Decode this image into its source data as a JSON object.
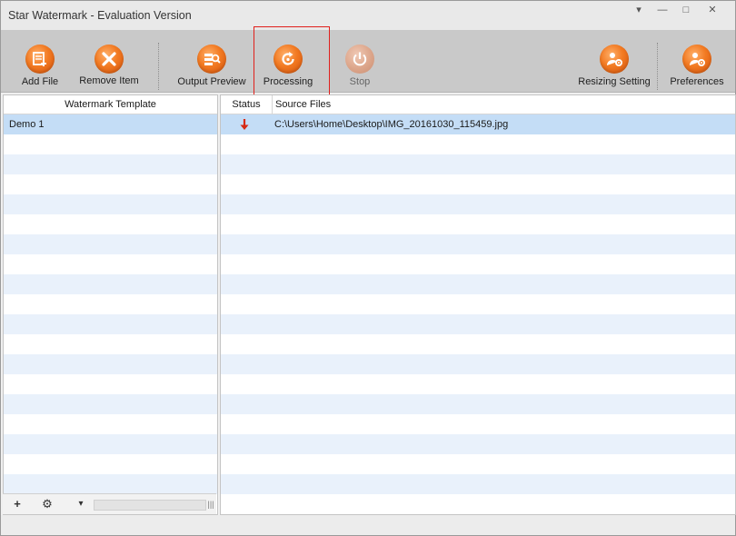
{
  "window": {
    "title": "Star Watermark - Evaluation Version",
    "controls": {
      "dropdown": "▾",
      "minimize": "—",
      "maximize": "□",
      "close": "✕"
    }
  },
  "toolbar": {
    "add_file": "Add File",
    "remove_item": "Remove Item",
    "output_preview": "Output Preview",
    "processing": "Processing",
    "stop": "Stop",
    "resizing_setting": "Resizing Setting",
    "preferences": "Preferences"
  },
  "template_panel": {
    "header": "Watermark Template",
    "items": [
      "Demo 1"
    ]
  },
  "files_panel": {
    "columns": {
      "status": "Status",
      "source": "Source Files"
    },
    "rows": [
      {
        "status_icon": "down-arrow-icon",
        "source": "C:\\Users\\Home\\Desktop\\IMG_20161030_115459.jpg"
      }
    ]
  },
  "bottom_bar": {
    "add": "+",
    "settings": "⚙",
    "settings_menu": "▾",
    "grip": "|||"
  },
  "colors": {
    "accent_orange": "#f27a22",
    "selected_row": "#c4ddf6",
    "alt_row": "#e9f1fb",
    "highlight_box": "#e0201c",
    "status_arrow": "#d62a14"
  }
}
